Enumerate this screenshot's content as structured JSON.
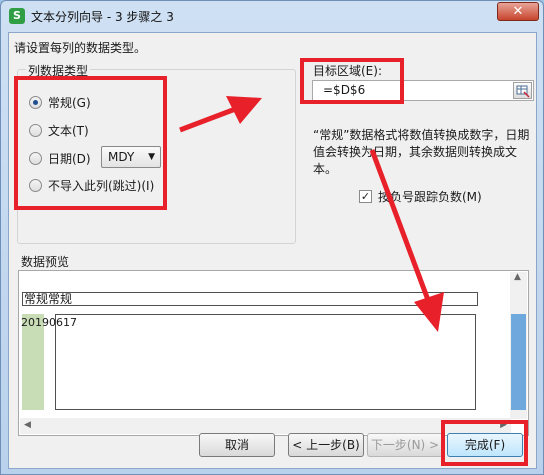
{
  "window": {
    "title": "文本分列向导 - 3 步骤之 3",
    "app_icon": "S",
    "close_glyph": "✕"
  },
  "instruction": "请设置每列的数据类型。",
  "column_type": {
    "legend": "列数据类型",
    "options": [
      {
        "label": "常规(G)",
        "checked": true
      },
      {
        "label": "文本(T)",
        "checked": false
      },
      {
        "label": "日期(D)",
        "checked": false
      },
      {
        "label": "不导入此列(跳过)(I)",
        "checked": false
      }
    ],
    "date_format": "MDY"
  },
  "destination": {
    "label": "目标区域(E):",
    "value": "=$D$6"
  },
  "description": "“常规”数据格式将数值转换成数字，日期值会转换为日期，其余数据则转换成文本。",
  "negative_checkbox": {
    "label": "按负号跟踪负数(M)",
    "checked": true
  },
  "preview": {
    "legend": "数据预览",
    "header": "常规常规",
    "cell": "20190617"
  },
  "buttons": {
    "cancel": "取消",
    "back": "< 上一步(B)",
    "next": "下一步(N) >",
    "finish": "完成(F)"
  },
  "annotation_color": "#e8202a"
}
